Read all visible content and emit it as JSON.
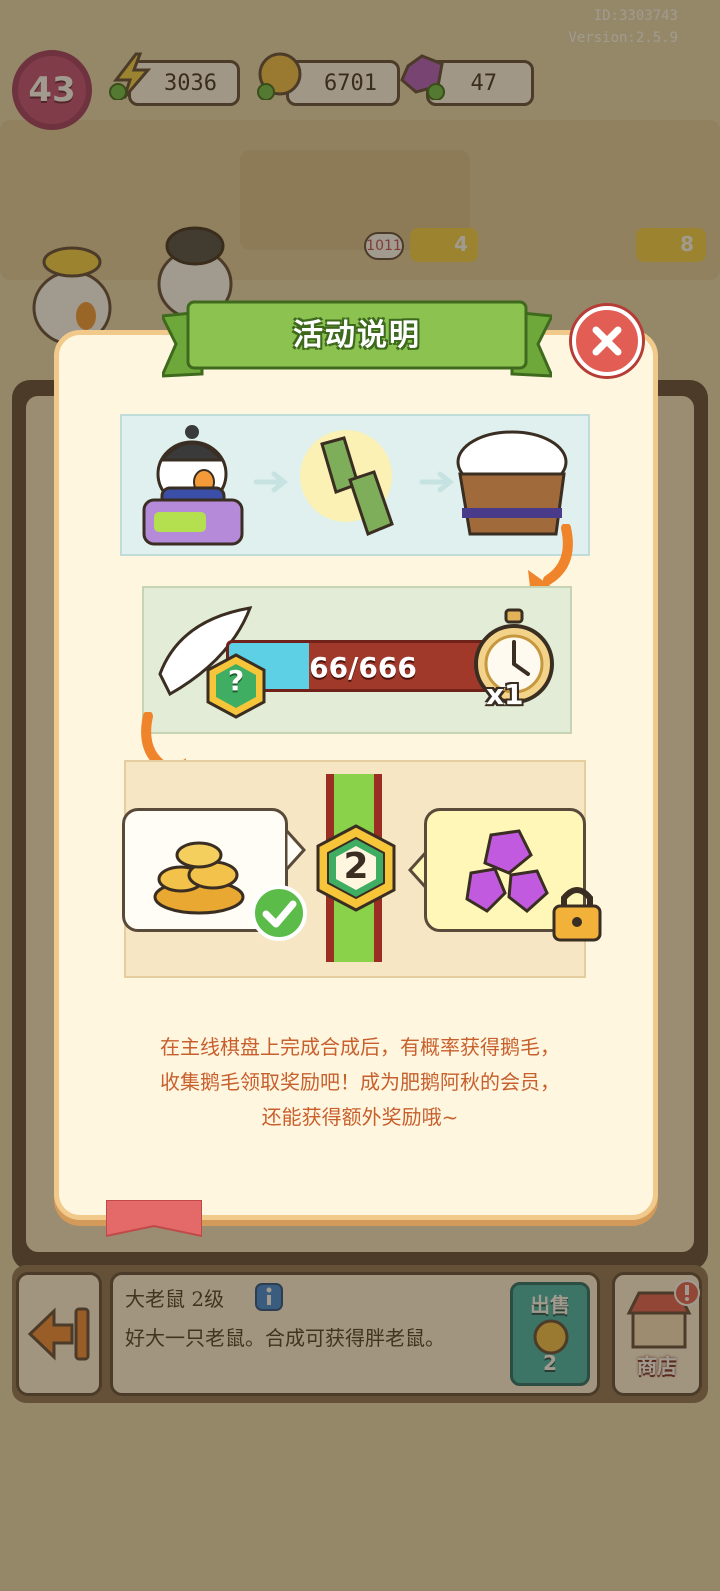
{
  "header": {
    "id_text": "ID:3303743",
    "version_text": "Version:2.5.9",
    "player_level": "43",
    "resources": [
      {
        "name": "energy",
        "value": "3036",
        "color": "#f3d34a"
      },
      {
        "name": "coins",
        "value": "6701",
        "color": "#f2c24a"
      },
      {
        "name": "gems",
        "value": "47",
        "color": "#b05cc9"
      }
    ]
  },
  "board_badges": {
    "count_badge": "1011",
    "star_left": "4",
    "star_right": "8"
  },
  "modal": {
    "title": "活动说明",
    "close_icon": "close-icon",
    "progress": {
      "text": "66/666",
      "current": 66,
      "total": 666,
      "question_badge": "?",
      "multiplier": "x1"
    },
    "reward_level": "2",
    "instructions": [
      "在主线棋盘上完成合成后，有概率获得鹅毛，",
      "收集鹅毛领取奖励吧！成为肥鹅阿秋的会员，",
      "还能获得额外奖励哦~"
    ]
  },
  "bottom": {
    "item_name": "大老鼠 2级",
    "item_description": "好大一只老鼠。合成可获得胖老鼠。",
    "sell_label": "出售",
    "sell_price": "2",
    "shop_label": "商店"
  },
  "colors": {
    "title_green": "#8cc350",
    "close_red": "#e25e55",
    "text_orange": "#c8602e",
    "modal_bg": "#fff6e0"
  }
}
